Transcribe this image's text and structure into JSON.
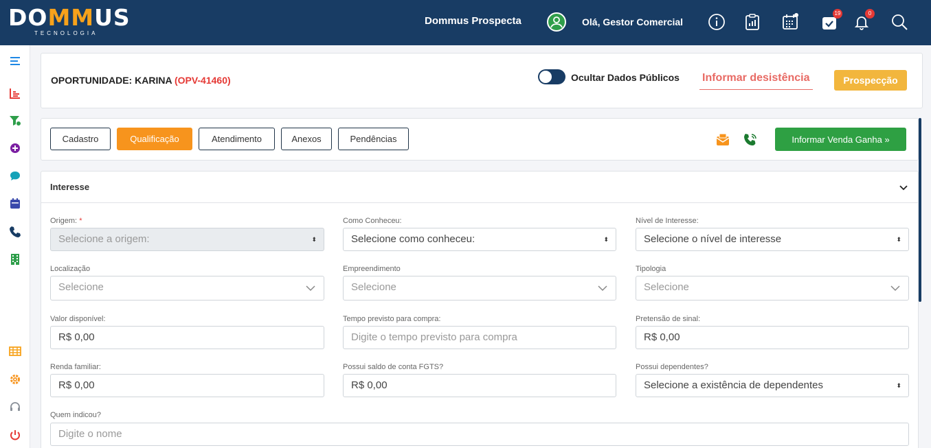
{
  "header": {
    "logo_text_left": "DO",
    "logo_text_mid": "MM",
    "logo_text_right": "US",
    "logo_sub": "TECNOLOGIA",
    "app_name": "Dommus Prospecta",
    "greeting": "Olá, Gestor Comercial",
    "cart_badge": "19",
    "bell_badge": "0"
  },
  "opportunity": {
    "title": "OPORTUNIDADE: KARINA",
    "code": "(OPV-41460)",
    "toggle_label": "Ocultar Dados Públicos",
    "desist_label": "Informar desistência",
    "stage": "Prospecção"
  },
  "tabs": [
    {
      "label": "Cadastro"
    },
    {
      "label": "Qualificação"
    },
    {
      "label": "Atendimento"
    },
    {
      "label": "Anexos"
    },
    {
      "label": "Pendências"
    }
  ],
  "win_button": "Informar Venda Ganha »",
  "section": {
    "title": "Interesse"
  },
  "fields": {
    "origem": {
      "label": "Origem:",
      "required": "*",
      "placeholder": "Selecione a origem:"
    },
    "como_conheceu": {
      "label": "Como Conheceu:",
      "placeholder": "Selecione como conheceu:"
    },
    "nivel": {
      "label": "Nível de Interesse:",
      "placeholder": "Selecione o nível de interesse"
    },
    "localizacao": {
      "label": "Localização",
      "placeholder": "Selecione"
    },
    "empreendimento": {
      "label": "Empreendimento",
      "placeholder": "Selecione"
    },
    "tipologia": {
      "label": "Tipologia",
      "placeholder": "Selecione"
    },
    "valor": {
      "label": "Valor disponível:",
      "value": "R$ 0,00"
    },
    "tempo": {
      "label": "Tempo previsto para compra:",
      "placeholder": "Digite o tempo previsto para compra"
    },
    "sinal": {
      "label": "Pretensão de sinal:",
      "value": "R$ 0,00"
    },
    "renda": {
      "label": "Renda familiar:",
      "value": "R$ 0,00"
    },
    "fgts": {
      "label": "Possui saldo de conta FGTS?",
      "value": "R$ 0,00"
    },
    "dependentes": {
      "label": "Possui dependentes?",
      "placeholder": "Selecione a existência de dependentes"
    },
    "indicou": {
      "label": "Quem indicou?",
      "placeholder": "Digite o nome"
    }
  },
  "colors": {
    "header_bg": "#183c64",
    "accent_orange": "#f7941d",
    "success_green": "#2ea043",
    "danger_red": "#e53935",
    "stage_yellow": "#f2b63d"
  }
}
